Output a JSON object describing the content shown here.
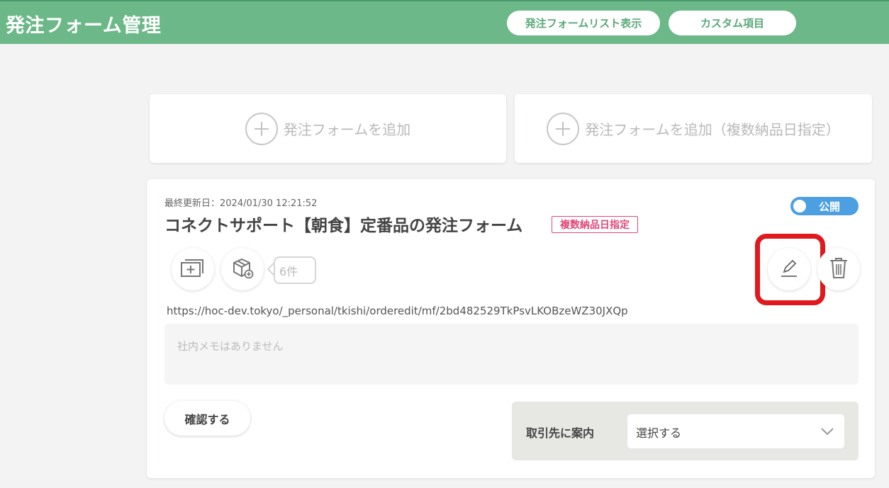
{
  "header": {
    "title": "発注フォーム管理",
    "list_button": "発注フォームリスト表示",
    "custom_button": "カスタム項目"
  },
  "add_cards": {
    "add_form": "発注フォームを追加",
    "add_form_multi": "発注フォームを追加（複数納品日指定）"
  },
  "form": {
    "updated": "最終更新日：2024/01/30 12:21:52",
    "title": "コネクトサポート【朝食】定番品の発注フォーム",
    "badge": "複数納品日指定",
    "toggle_label": "公開",
    "count": "6件",
    "url": "https://hoc-dev.tokyo/_personal/tkishi/orderedit/mf/2bd482529TkPsvLKOBzeWZ30JXQp",
    "memo_placeholder": "社内メモはありません",
    "confirm_button": "確認する",
    "guide_label": "取引先に案内",
    "guide_select_value": "選択する"
  },
  "colors": {
    "header_bg": "#6cb888",
    "accent_green": "#5aa97a",
    "toggle_blue": "#4c9fe0",
    "badge_pink": "#e04877",
    "highlight_red": "#e0191f"
  },
  "icons": [
    "plus-icon",
    "add-image-icon",
    "product-box-icon",
    "edit-pencil-icon",
    "trash-icon",
    "chevron-down-icon"
  ]
}
